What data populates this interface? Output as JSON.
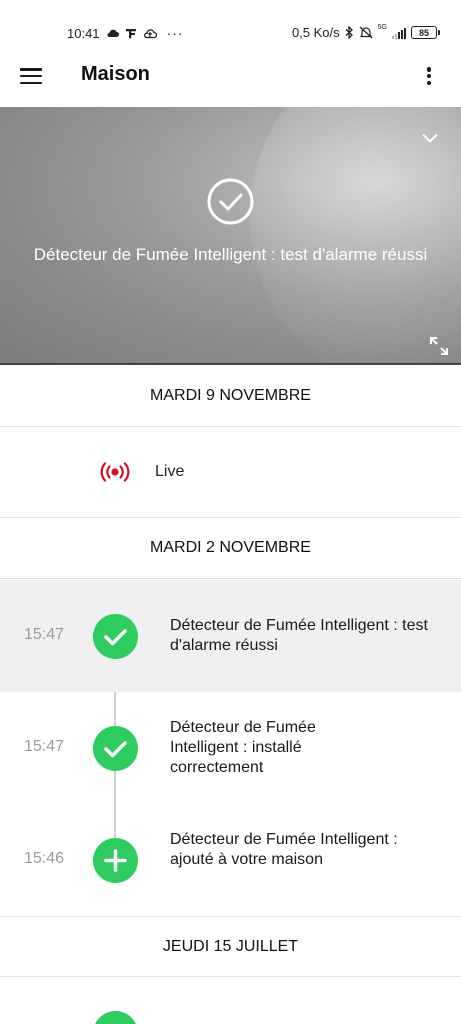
{
  "status_bar": {
    "time": "10:41",
    "left_icons": [
      "cloud-icon",
      "signal-f-icon",
      "cloud-upload-icon",
      "more-dots-icon"
    ],
    "left_more": "···",
    "speed": "0,5 Ko/s",
    "network": "5G",
    "battery": "85"
  },
  "app_bar": {
    "title": "Maison"
  },
  "hero": {
    "caption": "Détecteur de Fumée Intelligent : test d'alarme réussi"
  },
  "timeline": {
    "sections": [
      {
        "date": "MARDI 9 NOVEMBRE"
      },
      {
        "date": "MARDI 2 NOVEMBRE"
      },
      {
        "date": "JEUDI 15 JUILLET"
      }
    ],
    "live_label": "Live",
    "events": [
      {
        "time": "15:47",
        "icon": "check-icon",
        "text": "Détecteur de Fumée Intelligent : test d'alarme réussi"
      },
      {
        "time": "15:47",
        "icon": "check-icon",
        "text": "Détecteur de Fumée Intelligent : installé correctement"
      },
      {
        "time": "15:46",
        "icon": "plus-icon",
        "text": "Détecteur de Fumée Intelligent : ajouté à votre maison"
      }
    ]
  },
  "colors": {
    "accent_green": "#2ecc5f",
    "live_red": "#d0122b",
    "muted_time": "#9a9a9a",
    "highlight_row": "#f0f0f0"
  }
}
